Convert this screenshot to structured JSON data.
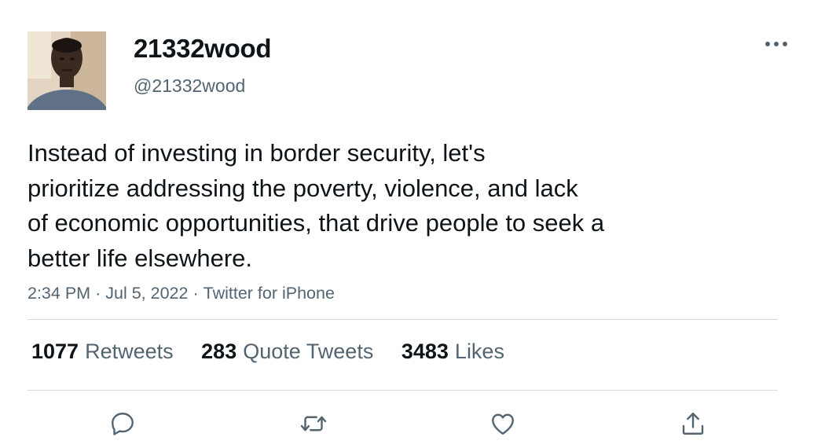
{
  "user": {
    "display_name": "21332wood",
    "handle": "@21332wood"
  },
  "tweet": {
    "text_lines": [
      "Instead of investing in border security, let's",
      "prioritize addressing the poverty, violence, and lack",
      "of economic opportunities, that drive people to seek a",
      "better life elsewhere."
    ],
    "time": "2:34 PM",
    "date": "Jul 5, 2022",
    "source": "Twitter for iPhone",
    "separator": "·"
  },
  "stats": {
    "retweets": {
      "count": "1077",
      "label": "Retweets"
    },
    "quotes": {
      "count": "283",
      "label": "Quote Tweets"
    },
    "likes": {
      "count": "3483",
      "label": "Likes"
    }
  },
  "icons": {
    "more": "more-horizontal-icon",
    "reply": "reply-icon",
    "retweet": "retweet-icon",
    "like": "heart-icon",
    "share": "share-icon"
  },
  "colors": {
    "text": "#0f1419",
    "secondary": "#536471",
    "divider": "#cfd9de"
  }
}
